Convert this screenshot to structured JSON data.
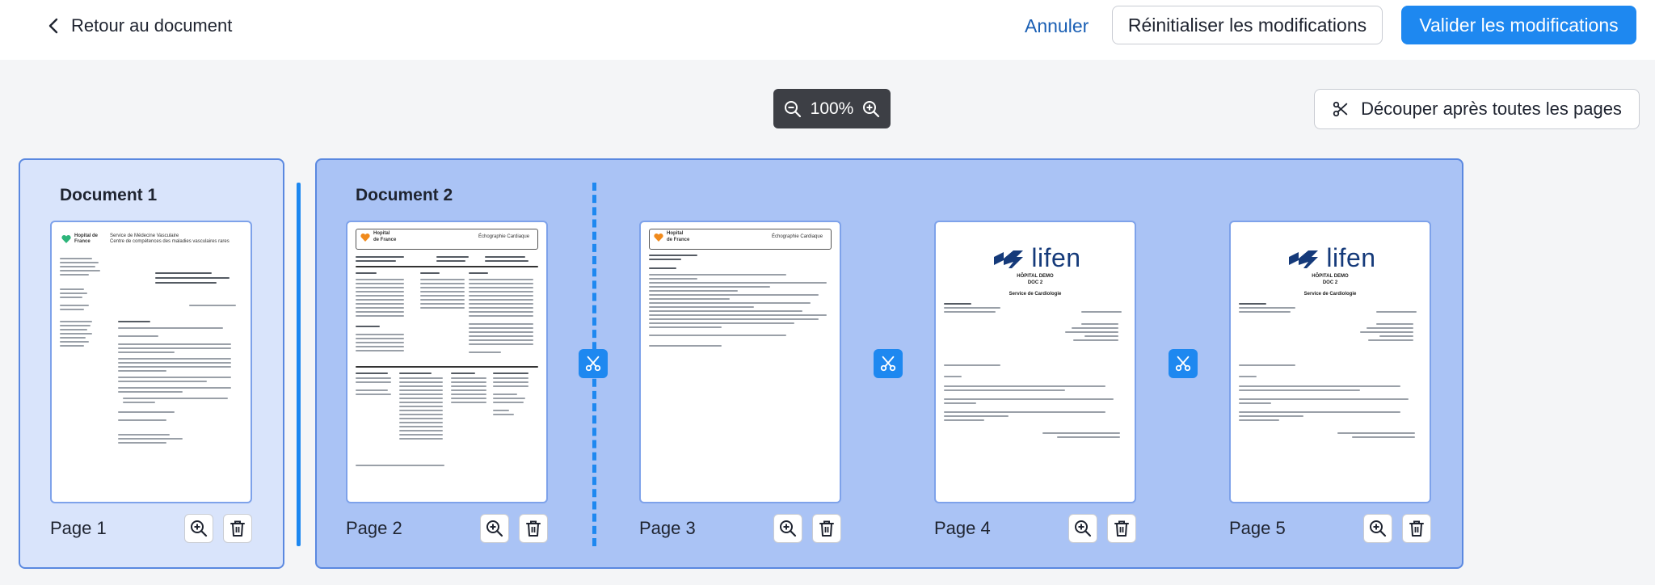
{
  "header": {
    "back_label": "Retour au document",
    "cancel_label": "Annuler",
    "reset_label": "Réinitialiser les modifications",
    "validate_label": "Valider les modifications"
  },
  "toolbar": {
    "zoom_value": "100%",
    "cut_all_label": "Découper après toutes les pages"
  },
  "documents": [
    {
      "title": "Document 1",
      "pages": [
        {
          "label": "Page 1"
        }
      ]
    },
    {
      "title": "Document 2",
      "pages": [
        {
          "label": "Page 2"
        },
        {
          "label": "Page 3"
        },
        {
          "label": "Page 4"
        },
        {
          "label": "Page 5"
        }
      ]
    }
  ],
  "thumbnails": {
    "p1": {
      "logo_line1": "Hopital de",
      "logo_line2": "France",
      "service_line1": "Service de Médecine Vasculaire",
      "service_line2": "Centre de compétences des maladies vasculaires rares"
    },
    "p2": {
      "logo_line1": "Hopital",
      "logo_line2": "de France",
      "exam_title": "Échographie Cardiaque"
    },
    "p3": {
      "logo_line1": "Hopital",
      "logo_line2": "de France",
      "exam_title": "Échographie Cardiaque"
    },
    "p4": {
      "brand": "lifen",
      "hospital": "HÔPITAL DEMO",
      "subtitle": "DOC 2",
      "service": "Service de Cardiologie"
    },
    "p5": {
      "brand": "lifen",
      "hospital": "HÔPITAL DEMO",
      "subtitle": "DOC 2",
      "service": "Service de Cardiologie"
    }
  },
  "colors": {
    "accent": "#1e88f0",
    "doc1_bg": "#d9e4fb",
    "doc2_bg": "#aac3f5",
    "lifen_blue": "#153a7a",
    "logo_orange": "#f08a1c",
    "logo_green": "#2db57a"
  }
}
